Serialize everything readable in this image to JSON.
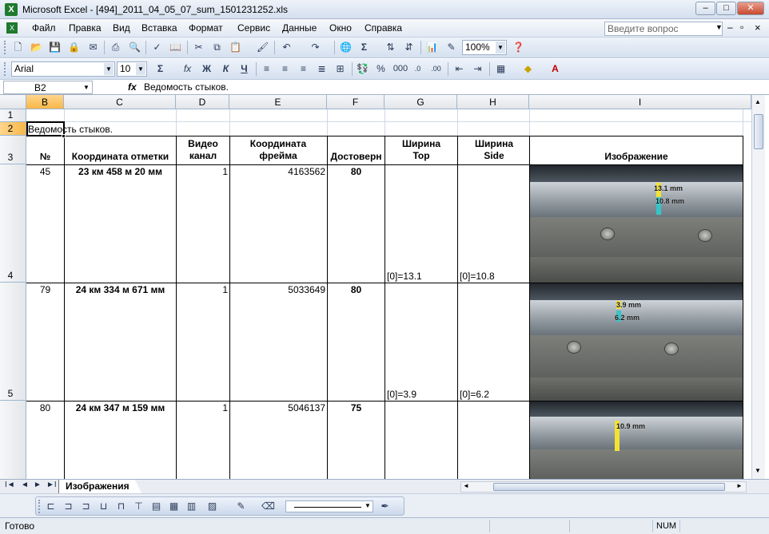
{
  "window": {
    "title": "Microsoft Excel - [494]_2011_04_05_07_sum_1501231252.xls",
    "icon_letter": "X",
    "minimize_glyph": "–",
    "maximize_glyph": "□",
    "close_glyph": "✕"
  },
  "menu": {
    "items": [
      "Файл",
      "Правка",
      "Вид",
      "Вставка",
      "Формат",
      "Сервис",
      "Данные",
      "Окно",
      "Справка"
    ],
    "help_placeholder": "Введите вопрос",
    "doc_controls": [
      "–",
      "▫",
      "×"
    ]
  },
  "standard_toolbar": {
    "zoom": "100%",
    "sum_glyph": "Σ"
  },
  "format_toolbar": {
    "font": "Arial",
    "size": "10",
    "bold": "Ж",
    "italic": "К",
    "underline": "Ч",
    "sum_glyph": "Σ",
    "fx_glyph": "fx",
    "percent": "%",
    "thousands": "000"
  },
  "formula_bar": {
    "name_box": "B2",
    "fx_label": "fx",
    "content": "Ведомость стыков."
  },
  "columns": [
    "B",
    "C",
    "D",
    "E",
    "F",
    "G",
    "H",
    "I"
  ],
  "selected_column": "B",
  "rows": [
    "1",
    "2",
    "3",
    "4",
    "5"
  ],
  "sheet": {
    "title_cell": "Ведомость стыков.",
    "headers": {
      "num": "№",
      "coord": "Координата отметки",
      "video": "Видео канал",
      "frame": "Координата фрейма",
      "conf": "Достоверн",
      "width_top": "Ширина Top",
      "width_side": "Ширина Side",
      "image": "Изображение"
    },
    "records": [
      {
        "num": "45",
        "coord": "23 км 458 м  20 мм",
        "video": "1",
        "frame": "4163562",
        "conf": "80",
        "top": "[0]=13.1",
        "side": "[0]=10.8",
        "img_label_1": "13.1 mm",
        "img_label_2": "10.8 mm"
      },
      {
        "num": "79",
        "coord": "24 км 334 м 671 мм",
        "video": "1",
        "frame": "5033649",
        "conf": "80",
        "top": "[0]=3.9",
        "side": "[0]=6.2",
        "img_label_1": "3.9 mm",
        "img_label_2": "6.2 mm"
      },
      {
        "num": "80",
        "coord": "24 км 347 м 159 мм",
        "video": "1",
        "frame": "5046137",
        "conf": "75",
        "top": "",
        "side": "",
        "img_label_1": "10.9 mm",
        "img_label_2": ""
      }
    ]
  },
  "tabs": {
    "nav": [
      "I◄",
      "◄",
      "►",
      "►I"
    ],
    "active": "Изображения"
  },
  "status": {
    "text": "Готово",
    "num": "NUM"
  },
  "colors": {
    "selected_header": "#f7b748",
    "gridline": "#d0d7e5",
    "chrome": "#d5e0ef"
  }
}
